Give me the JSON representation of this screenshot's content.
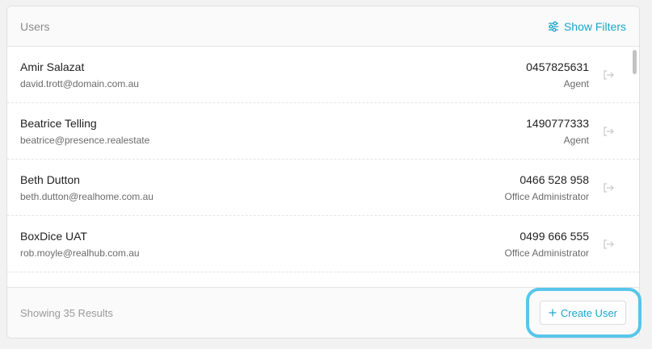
{
  "header": {
    "title": "Users",
    "filters_label": "Show Filters"
  },
  "users": [
    {
      "name": "Amir Salazat",
      "email": "david.trott@domain.com.au",
      "phone": "0457825631",
      "role": "Agent"
    },
    {
      "name": "Beatrice Telling",
      "email": "beatrice@presence.realestate",
      "phone": "1490777333",
      "role": "Agent"
    },
    {
      "name": "Beth Dutton",
      "email": "beth.dutton@realhome.com.au",
      "phone": "0466 528 958",
      "role": "Office Administrator"
    },
    {
      "name": "BoxDice UAT",
      "email": "rob.moyle@realhub.com.au",
      "phone": "0499 666 555",
      "role": "Office Administrator"
    }
  ],
  "footer": {
    "results_text": "Showing 35 Results",
    "create_label": "Create User"
  },
  "icons": {
    "filters": "sliders-icon",
    "login": "login-arrow-icon",
    "plus": "plus-icon"
  },
  "colors": {
    "accent": "#1aa5c9",
    "highlight": "#58c6ea"
  }
}
